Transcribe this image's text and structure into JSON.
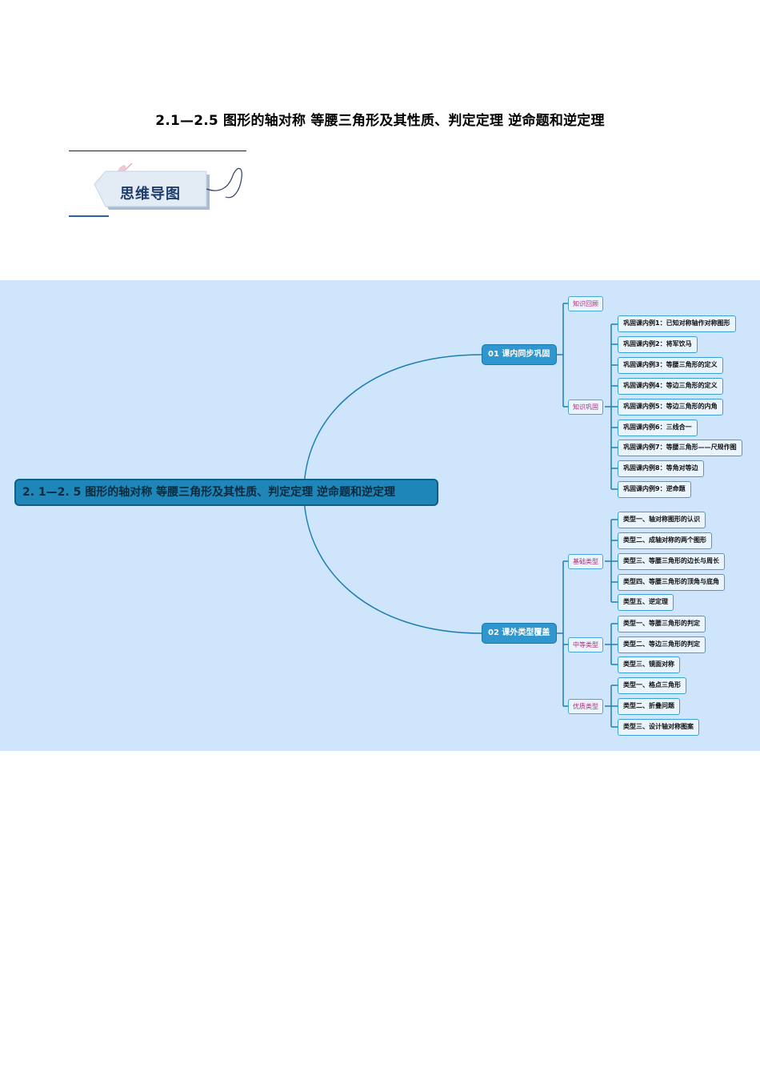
{
  "document": {
    "title": "2.1—2.5  图形的轴对称  等腰三角形及其性质、判定定理  逆命题和逆定理",
    "section_tag": "思维导图"
  },
  "mindmap": {
    "root": "2. 1—2. 5  图形的轴对称  等腰三角形及其性质、判定定理  逆命题和逆定理",
    "branches": [
      {
        "label": "01  课内同步巩固",
        "groups": [
          {
            "label": "知识回顾",
            "items": []
          },
          {
            "label": "知识巩固",
            "items": [
              "巩固课内例1：已知对称轴作对称图形",
              "巩固课内例2：将军饮马",
              "巩固课内例3：等腰三角形的定义",
              "巩固课内例4：等边三角形的定义",
              "巩固课内例5：等边三角形的内角",
              "巩固课内例6：三线合一",
              "巩固课内例7：等腰三角形——尺规作图",
              "巩固课内例8：等角对等边",
              "巩固课内例9：逆命题"
            ]
          }
        ]
      },
      {
        "label": "02  课外类型覆盖",
        "groups": [
          {
            "label": "基础类型",
            "items": [
              "类型一、轴对称图形的认识",
              "类型二、成轴对称的两个图形",
              "类型三、等腰三角形的边长与周长",
              "类型四、等腰三角形的顶角与底角",
              "类型五、逆定理"
            ]
          },
          {
            "label": "中等类型",
            "items": [
              "类型一、等腰三角形的判定",
              "类型二、等边三角形的判定",
              "类型三、镜面对称"
            ]
          },
          {
            "label": "优质类型",
            "items": [
              "类型一、格点三角形",
              "类型二、折叠问题",
              "类型三、设计轴对称图案"
            ]
          }
        ]
      }
    ]
  },
  "colors": {
    "map_background": "#cfe5fb",
    "root_fill": "#1e86b8",
    "branch_fill": "#2f96cf",
    "connector": "#1d7fb0",
    "group_text": "#b02a7a"
  }
}
